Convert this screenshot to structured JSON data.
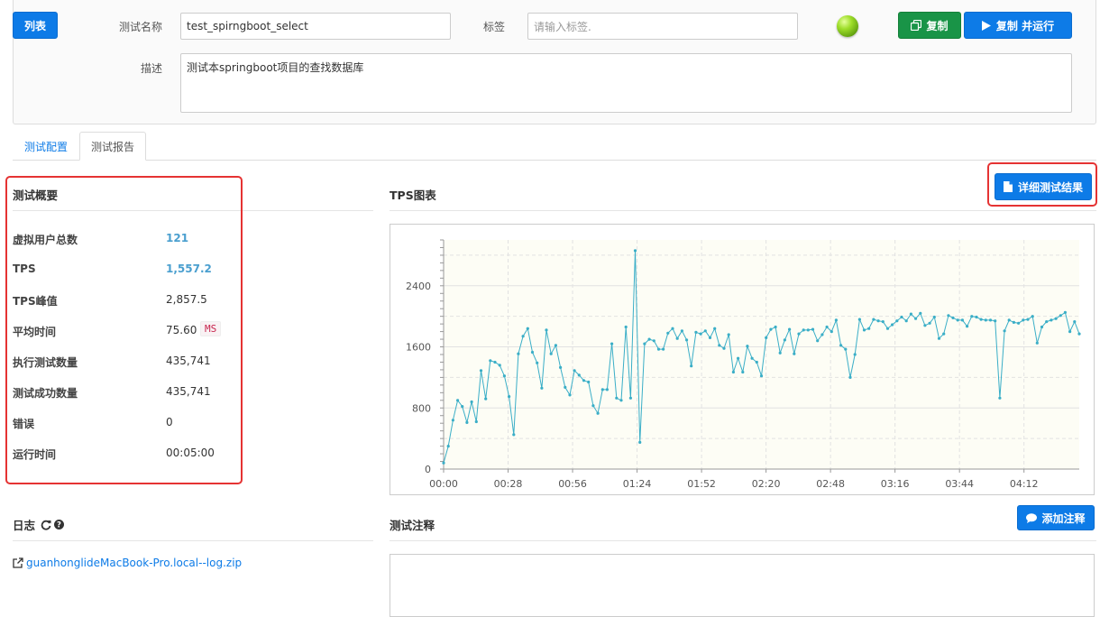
{
  "top": {
    "list_button": "列表",
    "name_label": "测试名称",
    "name_value": "test_spirngboot_select",
    "tag_label": "标签",
    "tag_placeholder": "请输入标签.",
    "copy_button": "复制",
    "copy_run_button": "复制 并运行",
    "desc_label": "描述",
    "desc_value": "测试本springboot项目的查找数据库",
    "status_color": "#7dc21e"
  },
  "tabs": [
    {
      "label": "测试配置"
    },
    {
      "label": "测试报告"
    }
  ],
  "summary": {
    "title": "测试概要",
    "rows": [
      {
        "label": "虚拟用户总数",
        "value": "121"
      },
      {
        "label": "TPS",
        "value": "1,557.2"
      },
      {
        "label": "TPS峰值",
        "value": "2,857.5"
      },
      {
        "label": "平均时间",
        "value": "75.60",
        "badge": "MS"
      },
      {
        "label": "执行测试数量",
        "value": "435,741"
      },
      {
        "label": "测试成功数量",
        "value": "435,741"
      },
      {
        "label": "错误",
        "value": "0"
      },
      {
        "label": "运行时间",
        "value": "00:05:00"
      }
    ]
  },
  "tps": {
    "title": "TPS图表",
    "detail_button": "详细测试结果"
  },
  "log": {
    "title": "日志",
    "file": "guanhonglideMacBook-Pro.local--log.zip"
  },
  "notes": {
    "title": "测试注释",
    "add_button": "添加注释"
  },
  "colors": {
    "primary": "#0d7be7",
    "success": "#199447",
    "highlight": "#e53333",
    "series": "#3aaec7"
  },
  "chart_data": {
    "type": "line",
    "x_ticks": [
      "00:00",
      "00:28",
      "00:56",
      "01:24",
      "01:52",
      "02:20",
      "02:48",
      "03:16",
      "03:44",
      "04:12"
    ],
    "y_ticks": [
      "0",
      "800",
      "1600",
      "2400"
    ],
    "ylim": [
      0,
      3000
    ],
    "xlim_seconds": [
      0,
      276
    ],
    "grid": true,
    "series": [
      {
        "values": [
          80,
          300,
          640,
          900,
          820,
          610,
          880,
          620,
          1290,
          920,
          1420,
          1400,
          1360,
          1220,
          950,
          450,
          1510,
          1740,
          1840,
          1530,
          1390,
          1060,
          1820,
          1510,
          1620,
          1330,
          1070,
          970,
          1290,
          1230,
          1160,
          1140,
          830,
          730,
          1040,
          1040,
          1640,
          930,
          900,
          1860,
          930,
          2860,
          350,
          1640,
          1700,
          1680,
          1570,
          1570,
          1780,
          1840,
          1710,
          1810,
          1690,
          1350,
          1790,
          1770,
          1810,
          1720,
          1840,
          1620,
          1580,
          1760,
          1270,
          1450,
          1270,
          1610,
          1450,
          1400,
          1220,
          1720,
          1830,
          1860,
          1520,
          1690,
          1830,
          1510,
          1770,
          1820,
          1820,
          1830,
          1680,
          1760,
          1860,
          1800,
          1950,
          1620,
          1570,
          1200,
          1500,
          1960,
          1820,
          1840,
          1960,
          1940,
          1930,
          1840,
          1890,
          1940,
          1990,
          1940,
          2030,
          1970,
          2040,
          1880,
          1910,
          1990,
          1710,
          1770,
          2010,
          1980,
          1950,
          1950,
          1870,
          2000,
          1990,
          1960,
          1950,
          1950,
          1940,
          930,
          1810,
          1950,
          1920,
          1910,
          1950,
          1960,
          2000,
          1650,
          1860,
          1930,
          1950,
          1970,
          2010,
          2050,
          1800,
          1930,
          1770
        ]
      }
    ]
  }
}
